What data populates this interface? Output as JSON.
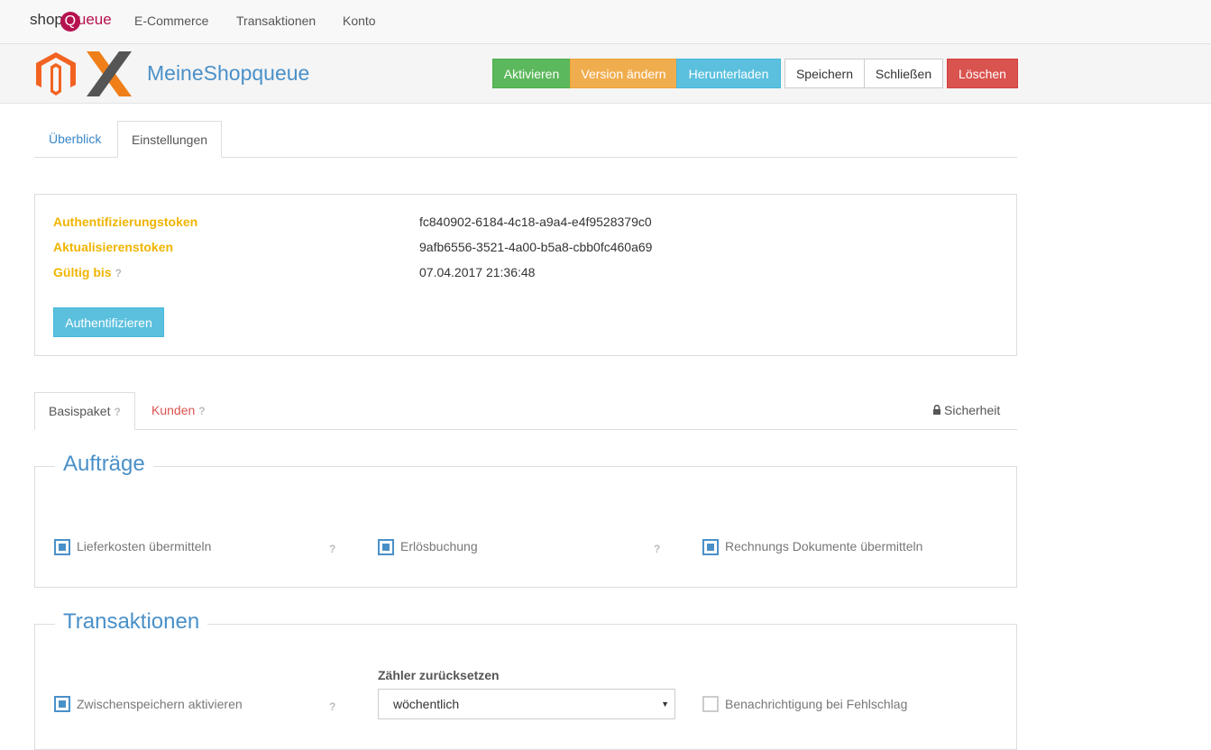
{
  "nav": {
    "logo": {
      "prefix": "shop",
      "q": "Q",
      "suffix": "ueue"
    },
    "links": [
      "E-Commerce",
      "Transaktionen",
      "Konto"
    ]
  },
  "header": {
    "shop_name": "MeineShopqueue",
    "buttons": {
      "activate": "Aktivieren",
      "change_version": "Version ändern",
      "download": "Herunterladen",
      "save": "Speichern",
      "close": "Schließen",
      "delete": "Löschen"
    }
  },
  "tabs": {
    "overview": "Überblick",
    "settings": "Einstellungen"
  },
  "tokens": {
    "auth_label": "Authentifizierungstoken",
    "auth_value": "fc840902-6184-4c18-a9a4-e4f9528379c0",
    "refresh_label": "Aktualisierenstoken",
    "refresh_value": "9afb6556-3521-4a00-b5a8-cbb0fc460a69",
    "valid_label": "Gültig bis",
    "valid_value": "07.04.2017 21:36:48",
    "auth_button": "Authentifizieren"
  },
  "subtabs": {
    "basic": "Basispaket",
    "customers": "Kunden",
    "security": "Sicherheit"
  },
  "help_mark": "?",
  "orders": {
    "title": "Aufträge",
    "options": [
      {
        "label": "Lieferkosten übermitteln",
        "checked": true
      },
      {
        "label": "Erlösbuchung",
        "checked": true
      },
      {
        "label": "Rechnungs Dokumente übermitteln",
        "checked": true
      }
    ]
  },
  "transactions": {
    "title": "Transaktionen",
    "cache_label": "Zwischenspeichern aktivieren",
    "cache_checked": true,
    "reset_label": "Zähler zurücksetzen",
    "reset_value": "wöchentlich",
    "notify_label": "Benachrichtigung bei Fehlschlag",
    "notify_checked": false
  },
  "colors": {
    "brand": "#b5124f",
    "accent": "#4a90c8",
    "token_label": "#f0b400",
    "danger": "#d9534f"
  }
}
